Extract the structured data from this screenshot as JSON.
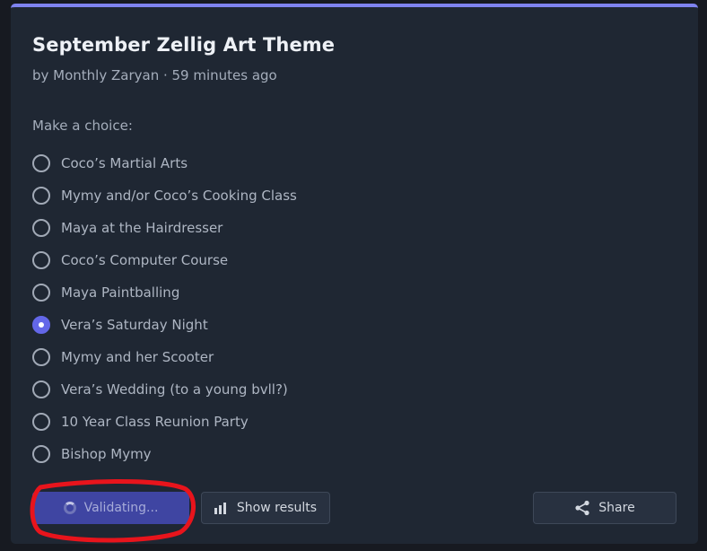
{
  "poll": {
    "title": "September Zellig Art Theme",
    "meta": "by Monthly Zaryan · 59 minutes ago",
    "prompt": "Make a choice:",
    "options": [
      {
        "label": "Coco’s Martial Arts",
        "selected": false
      },
      {
        "label": "Mymy and/or Coco’s Cooking Class",
        "selected": false
      },
      {
        "label": "Maya at the Hairdresser",
        "selected": false
      },
      {
        "label": "Coco’s Computer Course",
        "selected": false
      },
      {
        "label": "Maya Paintballing",
        "selected": false
      },
      {
        "label": "Vera’s Saturday Night",
        "selected": true
      },
      {
        "label": "Mymy and her Scooter",
        "selected": false
      },
      {
        "label": "Vera’s Wedding (to a young bvll?)",
        "selected": false
      },
      {
        "label": "10 Year Class Reunion Party",
        "selected": false
      },
      {
        "label": "Bishop Mymy",
        "selected": false
      }
    ]
  },
  "actions": {
    "validate_label": "Validating...",
    "validate_icon": "spinner-icon",
    "results_label": "Show results",
    "results_icon": "bar-chart-icon",
    "share_label": "Share",
    "share_icon": "share-icon"
  },
  "colors": {
    "accent": "#6367e8",
    "annotation": "#e8141c"
  }
}
